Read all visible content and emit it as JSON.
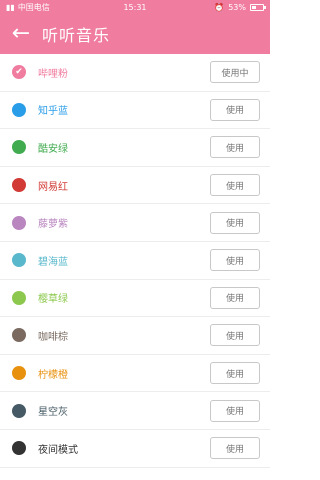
{
  "status_bar": {
    "carrier": "中国电信",
    "time": "15:31",
    "battery": "53%",
    "battery_level": 0.53
  },
  "app_bar": {
    "title": "听听音乐",
    "back_icon": "arrow-left-icon"
  },
  "themes": [
    {
      "name": "哔哩粉",
      "color": "#f07ca0",
      "button": "使用中",
      "selected": true
    },
    {
      "name": "知乎蓝",
      "color": "#2a9de8",
      "button": "使用",
      "selected": false
    },
    {
      "name": "酷安绿",
      "color": "#41ab50",
      "button": "使用",
      "selected": false
    },
    {
      "name": "网易红",
      "color": "#d23a36",
      "button": "使用",
      "selected": false
    },
    {
      "name": "藤萝紫",
      "color": "#ba86c0",
      "button": "使用",
      "selected": false
    },
    {
      "name": "碧海蓝",
      "color": "#59b8cc",
      "button": "使用",
      "selected": false
    },
    {
      "name": "樱草绿",
      "color": "#8cc84e",
      "button": "使用",
      "selected": false
    },
    {
      "name": "咖啡棕",
      "color": "#7a6a60",
      "button": "使用",
      "selected": false
    },
    {
      "name": "柠檬橙",
      "color": "#e8910f",
      "button": "使用",
      "selected": false
    },
    {
      "name": "星空灰",
      "color": "#455a64",
      "button": "使用",
      "selected": false
    },
    {
      "name": "夜间模式",
      "color": "#333333",
      "button": "使用",
      "selected": false
    }
  ]
}
